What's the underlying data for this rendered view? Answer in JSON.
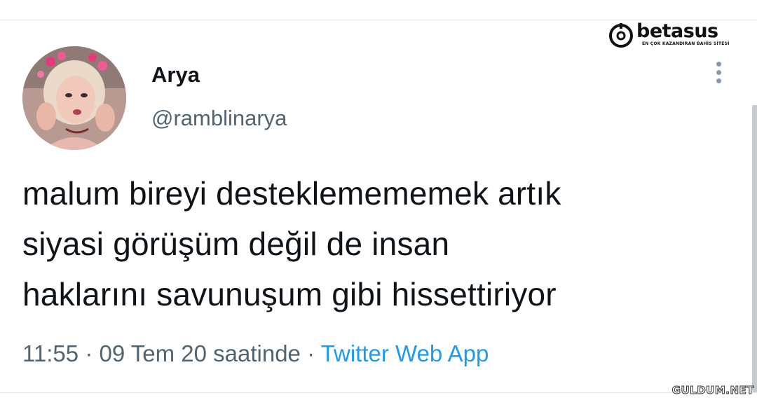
{
  "tweet": {
    "display_name": "Arya",
    "handle": "@ramblinarya",
    "text_lines": [
      "malum bireyi desteklemememek artık",
      "siyasi görüşüm değil de insan",
      "haklarını savunuşum gibi hissettiriyor"
    ],
    "time": "11:55",
    "separator": "·",
    "date": "09 Tem 20 saatinde",
    "source": "Twitter Web App",
    "more_icon": "more-vertical-icon"
  },
  "watermark": {
    "brand_name": "betasus",
    "brand_tagline": "EN ÇOK KAZANDIRAN BAHİS SİTESİ",
    "site_mark": "GULDUM.NET"
  },
  "colors": {
    "text": "#0f1419",
    "secondary": "#536471",
    "link": "#1d9bf0"
  }
}
